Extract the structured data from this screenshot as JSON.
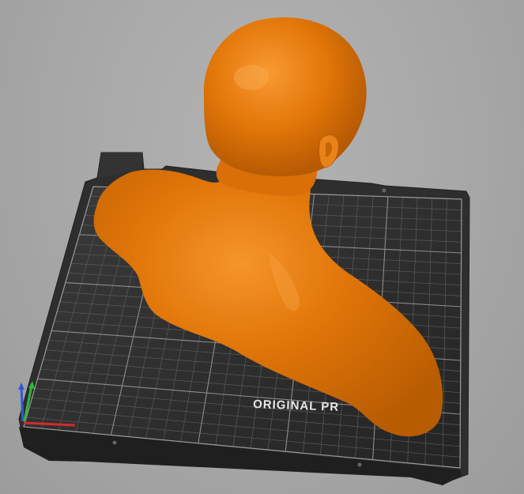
{
  "viewport": {
    "background_color": "#a7a7a7",
    "model_color": "#e07508",
    "bed_color": "#2a2a2a",
    "bed_label": "ORIGINAL PR"
  },
  "axes": {
    "x_color": "#d42b2b",
    "y_color": "#2fb83a",
    "z_color": "#3358d6"
  }
}
